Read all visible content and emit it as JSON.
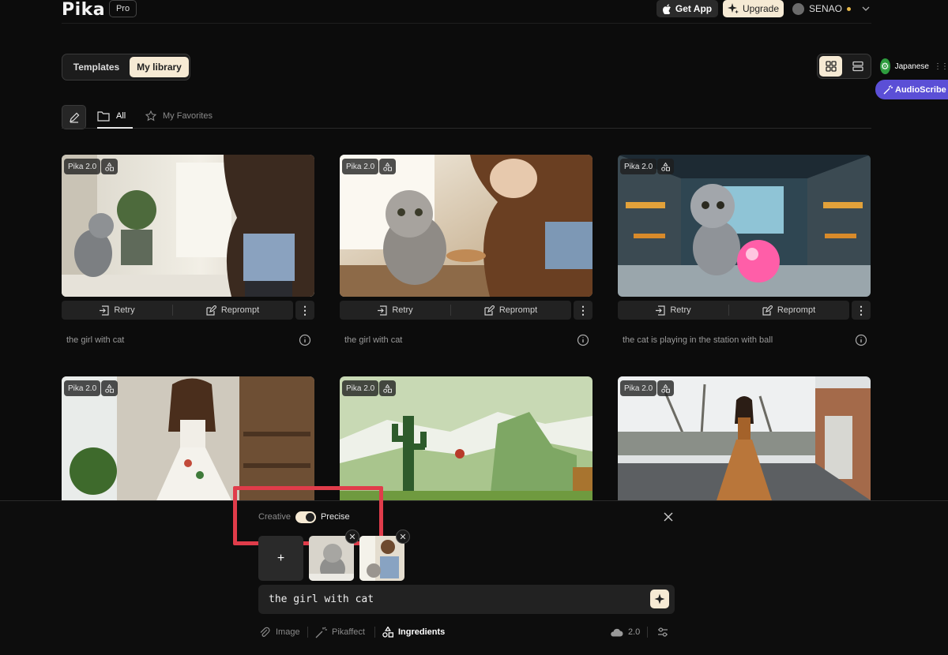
{
  "header": {
    "logo": "Pika",
    "plan_badge": "Pro",
    "get_app_label": "Get App",
    "upgrade_label": "Upgrade",
    "username": "SENAO"
  },
  "library_tabs": [
    {
      "label": "Templates",
      "active": false
    },
    {
      "label": "My library",
      "active": true
    }
  ],
  "view_modes": [
    "grid-view-icon",
    "list-view-icon"
  ],
  "extensions": {
    "translator_label": "Japanese",
    "audioscribe_label": "AudioScribe"
  },
  "filters": {
    "all_label": "All",
    "favorites_label": "My Favorites"
  },
  "cards": [
    {
      "model": "Pika 2.0",
      "caption": "the girl with cat",
      "retry": "Retry",
      "reprompt": "Reprompt"
    },
    {
      "model": "Pika 2.0",
      "caption": "the girl with cat",
      "retry": "Retry",
      "reprompt": "Reprompt"
    },
    {
      "model": "Pika 2.0",
      "caption": "the cat is playing in the station with ball",
      "retry": "Retry",
      "reprompt": "Reprompt"
    },
    {
      "model": "Pika 2.0"
    },
    {
      "model": "Pika 2.0"
    },
    {
      "model": "Pika 2.0"
    }
  ],
  "composer": {
    "mode_left": "Creative",
    "mode_right": "Precise",
    "mode_selected": "Precise",
    "prompt_value": "the girl with cat",
    "tools": {
      "image": "Image",
      "pikaffect": "Pikaffect",
      "ingredients": "Ingredients",
      "model_version": "2.0"
    }
  },
  "colors": {
    "accent": "#f6ead4",
    "highlight": "#e03c4a",
    "audioscribe": "#5b4fd6"
  }
}
